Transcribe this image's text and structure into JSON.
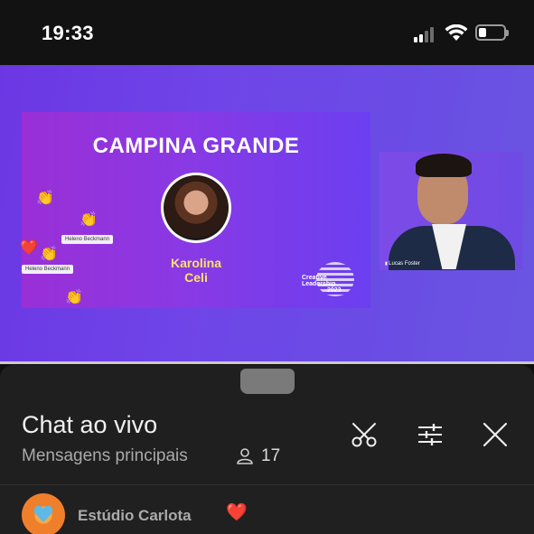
{
  "status_bar": {
    "time": "19:33",
    "battery_level": 0.3,
    "signal_bars": 2
  },
  "video": {
    "slide_title": "CAMPINA GRANDE",
    "speaker_first": "Karolina",
    "speaker_last": "Celi",
    "event_logo_text": [
      "Creative",
      "Leadership",
      "2023"
    ],
    "name_tags": [
      "Heleno Beckmann",
      "Heleno Beckmann"
    ],
    "camera_label": "Lucas Foster",
    "reactions": [
      "👏",
      "👏",
      "👏",
      "❤️",
      "👏"
    ]
  },
  "chat": {
    "title": "Chat ao vivo",
    "subtitle": "Mensagens principais",
    "viewer_count": "17",
    "icons": [
      "scissors-icon",
      "sliders-icon",
      "close-icon"
    ]
  },
  "message": {
    "author": "Estúdio Carlota",
    "emoji": "❤️"
  },
  "colors": {
    "video_bg": "#6b37e4",
    "sheet_bg": "#1f1f1f",
    "speaker_name": "#ffe06a",
    "heart": "#e8242b"
  }
}
